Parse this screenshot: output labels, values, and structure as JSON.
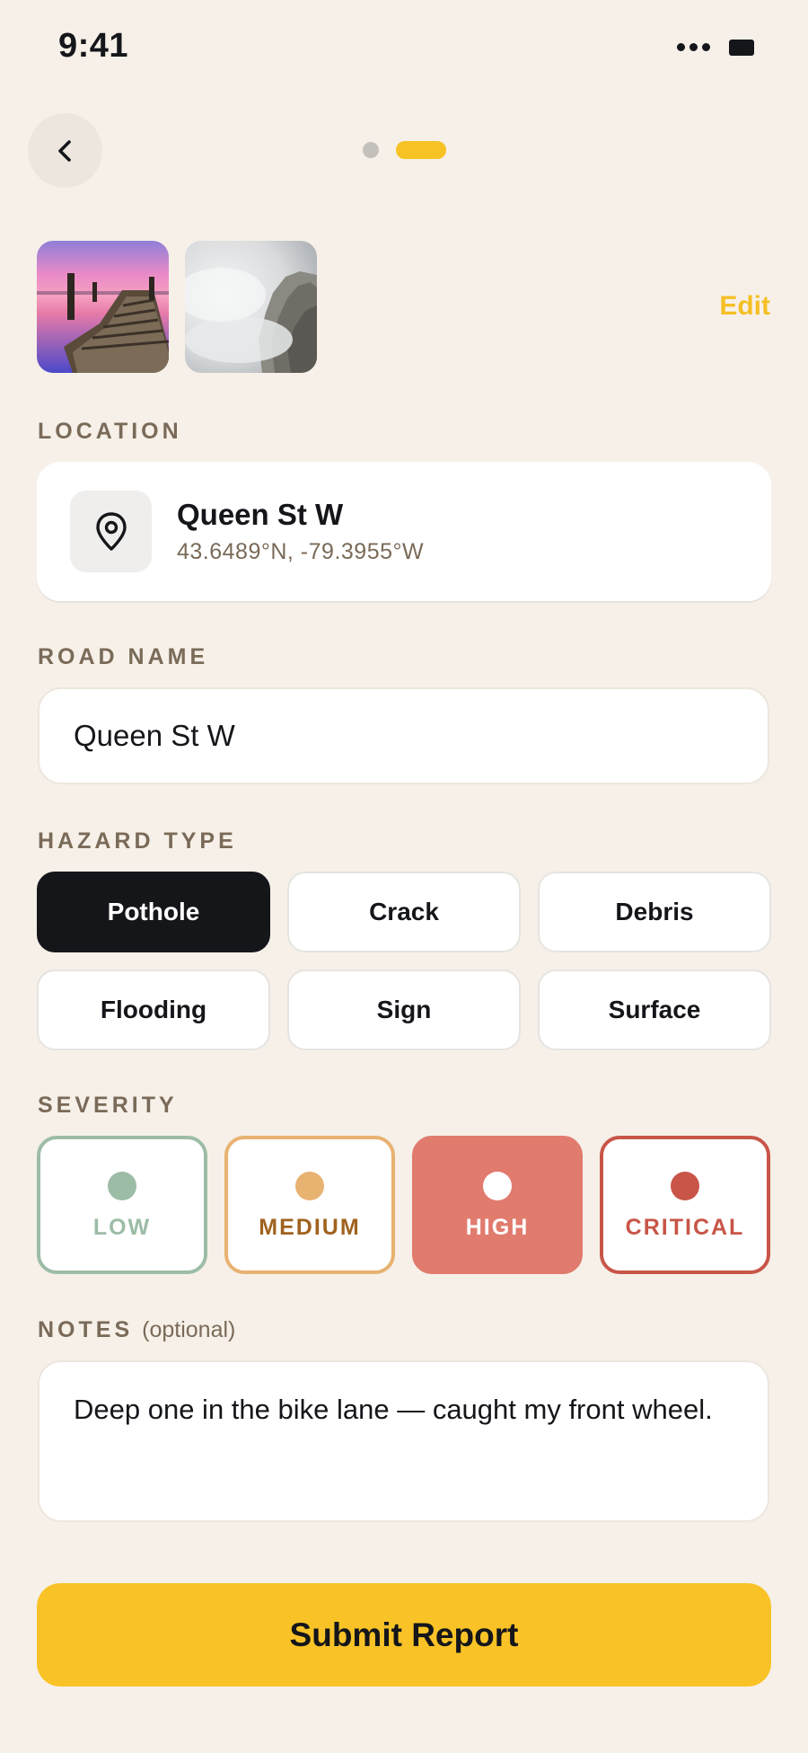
{
  "status_bar": {
    "time": "9:41"
  },
  "header": {
    "back_icon": "chevron-left-icon",
    "pager": {
      "pages": 2,
      "current": 2
    }
  },
  "photos": {
    "edit_label": "Edit",
    "count": 2
  },
  "location": {
    "label": "LOCATION",
    "icon": "map-pin-icon",
    "name": "Queen St W",
    "coords": "43.6489°N, -79.3955°W"
  },
  "road_name": {
    "label": "ROAD NAME",
    "value": "Queen St W"
  },
  "hazard_type": {
    "label": "HAZARD TYPE",
    "options": [
      "Pothole",
      "Crack",
      "Debris",
      "Flooding",
      "Sign",
      "Surface"
    ],
    "selected": "Pothole"
  },
  "severity": {
    "label": "SEVERITY",
    "options": [
      "LOW",
      "MEDIUM",
      "HIGH",
      "CRITICAL"
    ],
    "selected": "HIGH"
  },
  "notes": {
    "label": "NOTES",
    "optional": "(optional)",
    "value": "Deep one in the bike lane — caught my front wheel."
  },
  "submit_label": "Submit Report",
  "colors": {
    "background": "#f6f0e8",
    "accent": "#f9c327",
    "dark": "#14161a",
    "label": "#7a6a58",
    "low": "#9cbca6",
    "medium": "#e8b271",
    "high": "#e07b6e",
    "critical": "#c85548"
  }
}
